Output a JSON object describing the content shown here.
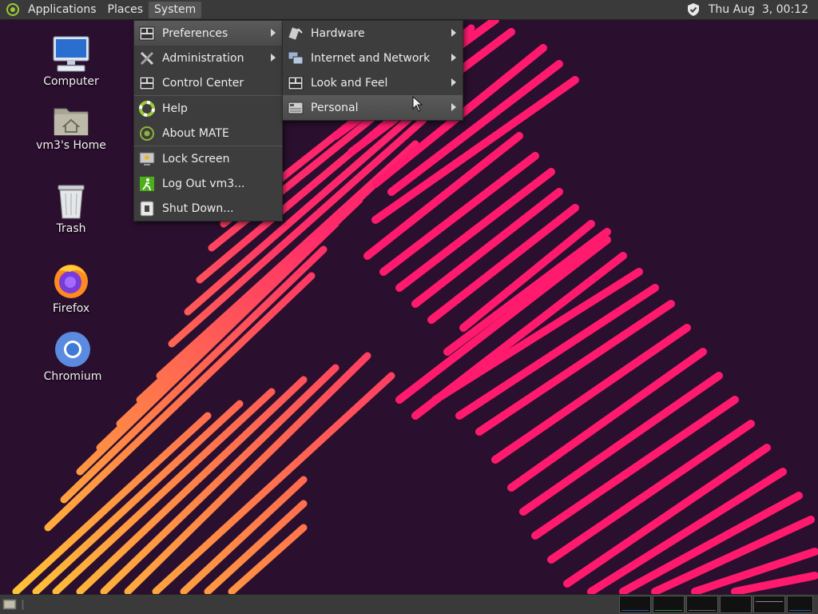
{
  "top_panel": {
    "menus": [
      "Applications",
      "Places",
      "System"
    ],
    "active_menu": "System",
    "clock": "Thu Aug  3, 00:12"
  },
  "desktop_icons": [
    {
      "label": "Computer"
    },
    {
      "label": "vm3's Home"
    },
    {
      "label": "Trash"
    },
    {
      "label": "Firefox"
    },
    {
      "label": "Chromium"
    }
  ],
  "system_menu": {
    "items": [
      {
        "label": "Preferences",
        "icon": "preferences-icon",
        "submenu": true
      },
      {
        "label": "Administration",
        "icon": "tools-icon",
        "submenu": true
      },
      {
        "label": "Control Center",
        "icon": "control-center-icon"
      },
      {
        "label": "Help",
        "icon": "help-icon"
      },
      {
        "label": "About MATE",
        "icon": "mate-icon"
      },
      {
        "label": "Lock Screen",
        "icon": "lock-icon"
      },
      {
        "label": "Log Out vm3...",
        "icon": "logout-icon"
      },
      {
        "label": "Shut Down...",
        "icon": "shutdown-icon"
      }
    ]
  },
  "preferences_submenu": {
    "items": [
      {
        "label": "Hardware",
        "icon": "hardware-icon"
      },
      {
        "label": "Internet and Network",
        "icon": "network-icon"
      },
      {
        "label": "Look and Feel",
        "icon": "appearance-icon"
      },
      {
        "label": "Personal",
        "icon": "personal-icon"
      }
    ],
    "highlighted": "Personal"
  },
  "colors": {
    "panel": "#3a3a3a",
    "menu_bg": "#3d3d3d",
    "wallpaper_bg": "#2a0f2e",
    "stripe_pink": "#ff1a6e",
    "stripe_yellow": "#ffc83a"
  }
}
